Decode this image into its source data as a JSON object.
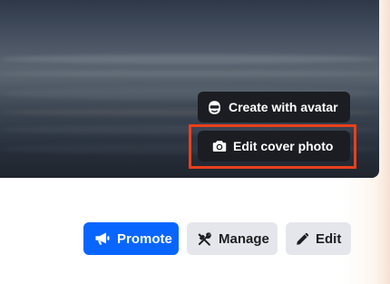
{
  "cover": {
    "avatar_button_label": "Create with avatar",
    "edit_cover_button_label": "Edit cover photo",
    "avatar_icon": "avatar-face-icon",
    "camera_icon": "camera-icon",
    "highlight_color": "#e8401c"
  },
  "actions": {
    "promote_label": "Promote",
    "promote_icon": "megaphone-icon",
    "manage_label": "Manage",
    "manage_icon": "tools-icon",
    "edit_label": "Edit",
    "edit_icon": "pencil-icon",
    "primary_color": "#0866ff",
    "secondary_color": "#e4e6eb"
  }
}
